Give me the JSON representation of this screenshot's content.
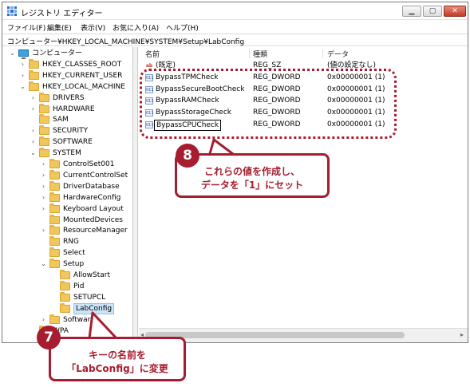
{
  "window": {
    "title": "レジストリ エディター",
    "controls": {
      "minimize": "▁",
      "maximize": "▢",
      "close": "✕"
    }
  },
  "menu": [
    "ファイル(F)",
    "編集(E)",
    "表示(V)",
    "お気に入り(A)",
    "ヘルプ(H)"
  ],
  "address": "コンピューター¥HKEY_LOCAL_MACHINE¥SYSTEM¥Setup¥LabConfig",
  "tree": [
    {
      "label": "コンピューター",
      "expanded": true,
      "icon": "computer-icon"
    },
    {
      "label": "HKEY_CLASSES_ROOT",
      "expanded": false,
      "icon": "folder-icon"
    },
    {
      "label": "HKEY_CURRENT_USER",
      "expanded": false,
      "icon": "folder-icon"
    },
    {
      "label": "HKEY_LOCAL_MACHINE",
      "expanded": true,
      "icon": "folder-icon"
    },
    {
      "label": "DRIVERS",
      "expanded": false,
      "icon": "folder-icon"
    },
    {
      "label": "HARDWARE",
      "expanded": false,
      "icon": "folder-icon"
    },
    {
      "label": "SAM",
      "expanded": false,
      "icon": "folder-icon"
    },
    {
      "label": "SECURITY",
      "expanded": false,
      "icon": "folder-icon"
    },
    {
      "label": "SOFTWARE",
      "expanded": false,
      "icon": "folder-icon"
    },
    {
      "label": "SYSTEM",
      "expanded": true,
      "icon": "folder-icon"
    },
    {
      "label": "ControlSet001",
      "expanded": false,
      "icon": "folder-icon"
    },
    {
      "label": "CurrentControlSet",
      "expanded": false,
      "icon": "folder-icon"
    },
    {
      "label": "DriverDatabase",
      "expanded": false,
      "icon": "folder-icon"
    },
    {
      "label": "HardwareConfig",
      "expanded": false,
      "icon": "folder-icon"
    },
    {
      "label": "Keyboard Layout",
      "expanded": false,
      "icon": "folder-icon"
    },
    {
      "label": "MountedDevices",
      "expanded": false,
      "icon": "folder-icon"
    },
    {
      "label": "ResourceManager",
      "expanded": false,
      "icon": "folder-icon"
    },
    {
      "label": "RNG",
      "expanded": false,
      "icon": "folder-icon"
    },
    {
      "label": "Select",
      "expanded": false,
      "icon": "folder-icon"
    },
    {
      "label": "Setup",
      "expanded": true,
      "icon": "folder-icon"
    },
    {
      "label": "AllowStart",
      "expanded": false,
      "icon": "folder-icon"
    },
    {
      "label": "Pid",
      "expanded": false,
      "icon": "folder-icon"
    },
    {
      "label": "SETUPCL",
      "expanded": false,
      "icon": "folder-icon"
    },
    {
      "label": "LabConfig",
      "expanded": false,
      "icon": "folder-icon",
      "selected": true
    },
    {
      "label": "Software",
      "expanded": false,
      "icon": "folder-icon"
    },
    {
      "label": "WPA",
      "expanded": false,
      "icon": "folder-icon"
    }
  ],
  "columns": {
    "name": "名前",
    "type": "種類",
    "data": "データ"
  },
  "values": [
    {
      "name": "(既定)",
      "type": "REG_SZ",
      "data": "(値の設定なし)",
      "icon": "string-value-icon"
    },
    {
      "name": "BypassTPMCheck",
      "type": "REG_DWORD",
      "data": "0x00000001 (1)",
      "icon": "binary-value-icon"
    },
    {
      "name": "BypassSecureBootCheck",
      "type": "REG_DWORD",
      "data": "0x00000001 (1)",
      "icon": "binary-value-icon"
    },
    {
      "name": "BypassRAMCheck",
      "type": "REG_DWORD",
      "data": "0x00000001 (1)",
      "icon": "binary-value-icon"
    },
    {
      "name": "BypassStorageCheck",
      "type": "REG_DWORD",
      "data": "0x00000001 (1)",
      "icon": "binary-value-icon"
    },
    {
      "name": "BypassCPUCheck",
      "type": "REG_DWORD",
      "data": "0x00000001 (1)",
      "icon": "binary-value-icon",
      "editing": true
    }
  ],
  "callouts": [
    {
      "number": "8",
      "lines": [
        "これらの値を作成し、",
        "データを「1」にセット"
      ]
    },
    {
      "number": "7",
      "lines": [
        "キーの名前を",
        "「LabConfig」に変更"
      ]
    }
  ],
  "colors": {
    "accent": "#a71c2e",
    "selection": "#cce4f7"
  }
}
